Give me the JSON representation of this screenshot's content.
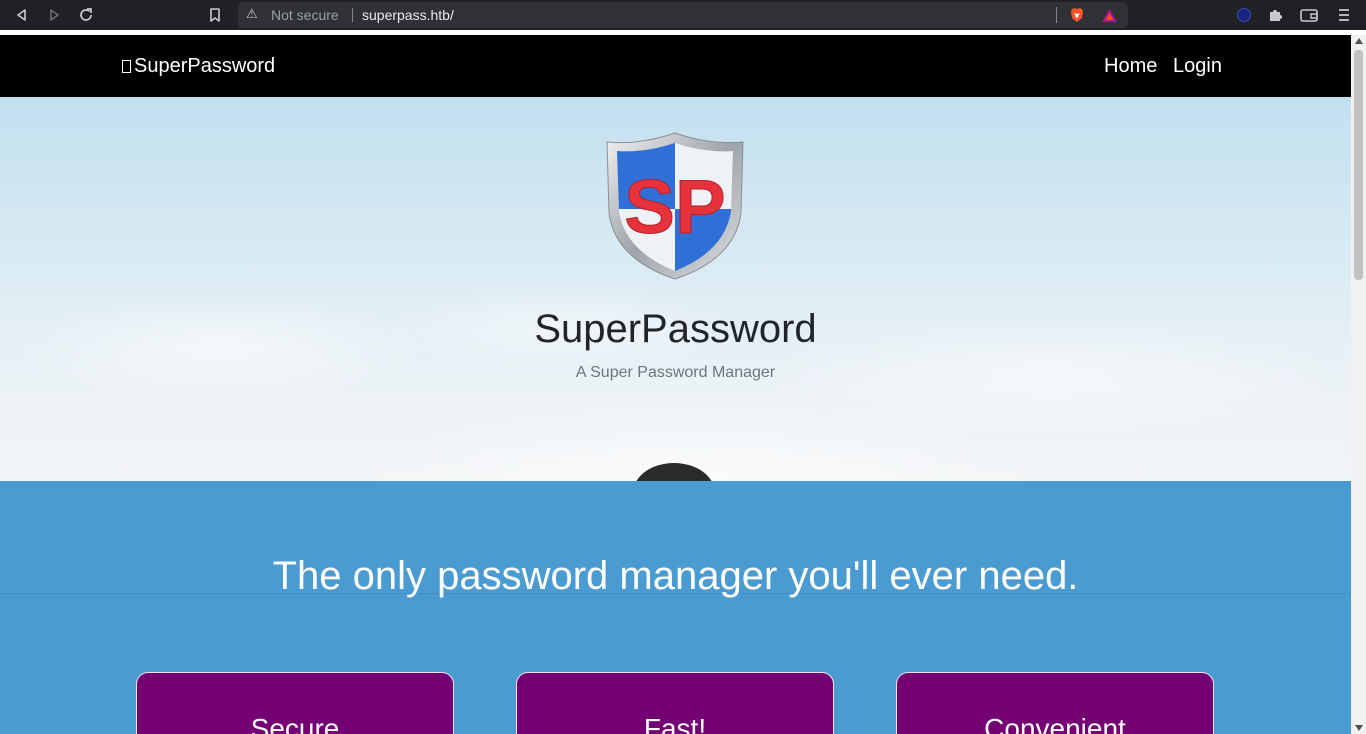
{
  "browser": {
    "security_label": "Not secure",
    "url": "superpass.htb/",
    "icons": [
      "back-icon",
      "forward-icon",
      "reload-icon",
      "bookmark-icon",
      "warning-icon",
      "brave-shields-icon",
      "brave-rewards-icon",
      "vpn-icon",
      "extensions-icon",
      "wallet-icon",
      "menu-icon"
    ]
  },
  "navbar": {
    "brand": "SuperPassword",
    "links": [
      "Home",
      "Login"
    ]
  },
  "hero": {
    "logo_text": "SP",
    "title": "SuperPassword",
    "subtitle": "A Super Password Manager"
  },
  "features": {
    "tagline": "The only password manager you'll ever need.",
    "cards": [
      {
        "title": "Secure"
      },
      {
        "title": "Fast!"
      },
      {
        "title": "Convenient"
      }
    ]
  },
  "colors": {
    "navbar_bg": "#000000",
    "features_bg": "#4b9bd3",
    "card_bg": "#740074"
  }
}
